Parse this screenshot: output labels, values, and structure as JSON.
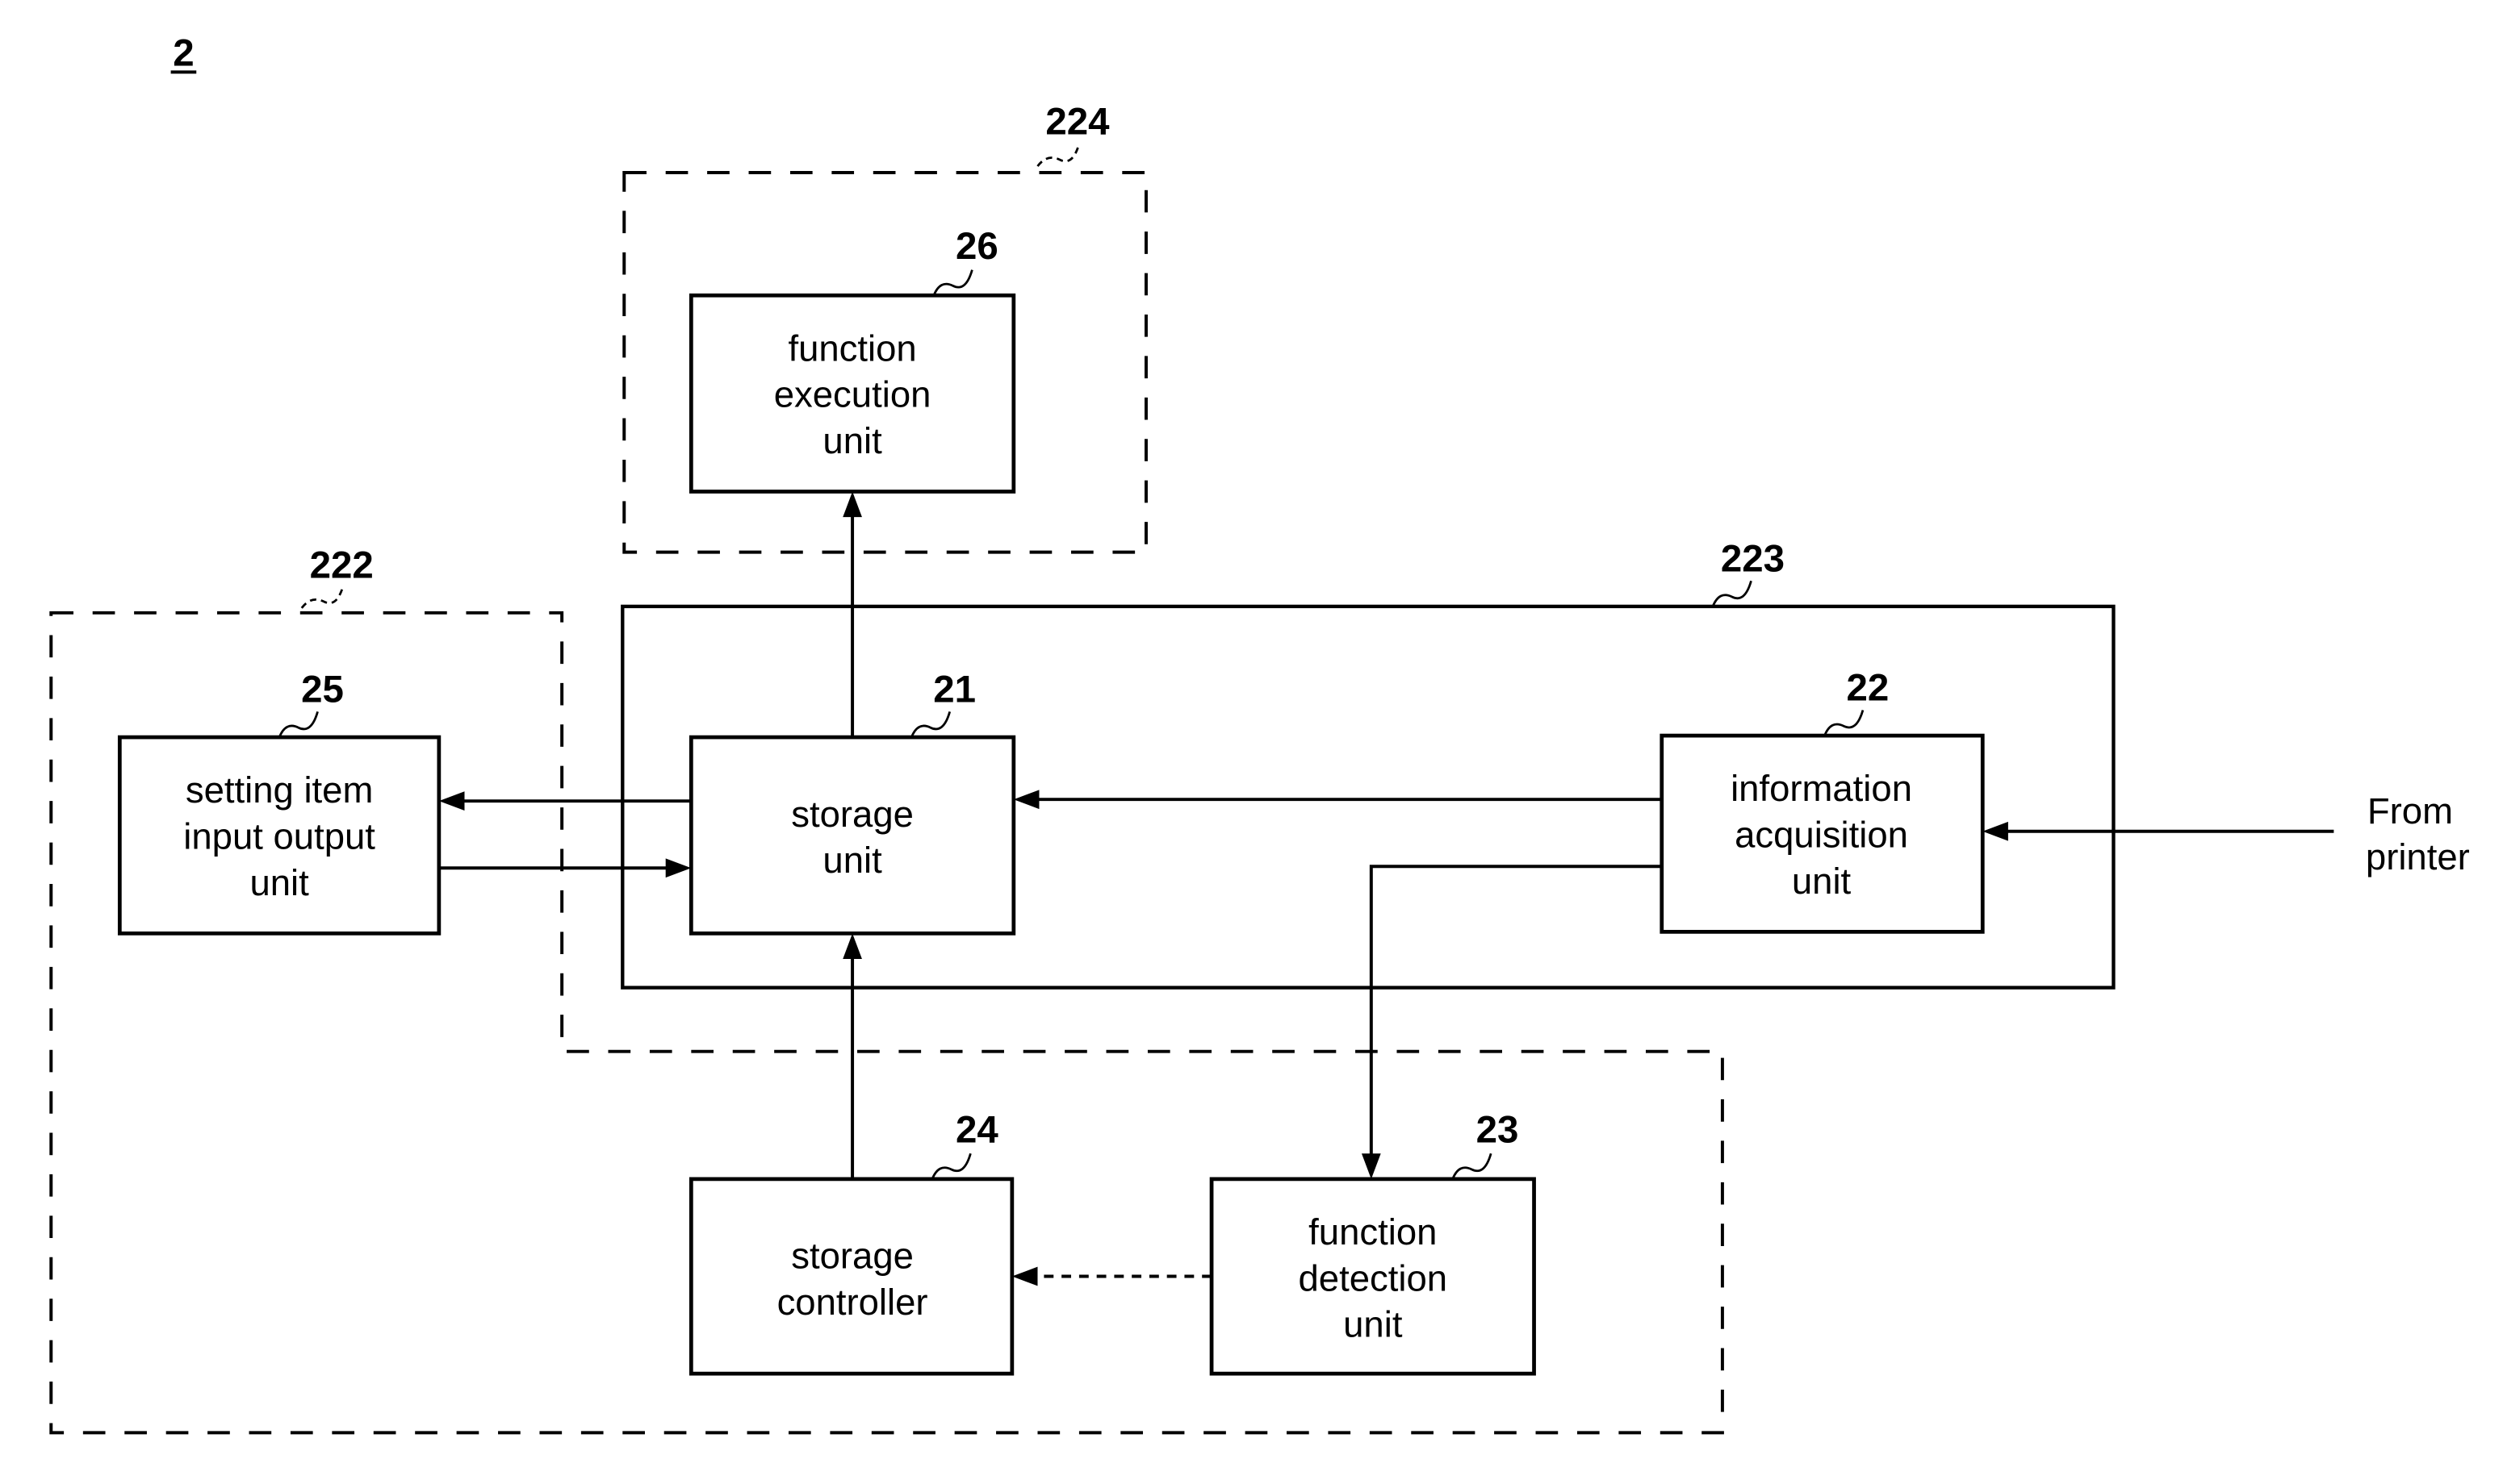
{
  "figure": {
    "number": "2"
  },
  "groups": [
    {
      "id": "222",
      "ref": "222",
      "style": "dashed",
      "contains": [
        "25",
        "24",
        "23"
      ]
    },
    {
      "id": "223",
      "ref": "223",
      "style": "solid",
      "contains": [
        "21",
        "22"
      ]
    },
    {
      "id": "224",
      "ref": "224",
      "style": "dashed",
      "contains": [
        "26"
      ]
    }
  ],
  "blocks": [
    {
      "id": "21",
      "ref": "21",
      "lines": [
        "storage",
        "unit"
      ]
    },
    {
      "id": "22",
      "ref": "22",
      "lines": [
        "information",
        "acquisition",
        "unit"
      ]
    },
    {
      "id": "23",
      "ref": "23",
      "lines": [
        "function",
        "detection",
        "unit"
      ]
    },
    {
      "id": "24",
      "ref": "24",
      "lines": [
        "storage",
        "controller"
      ]
    },
    {
      "id": "25",
      "ref": "25",
      "lines": [
        "setting item",
        "input output",
        "unit"
      ]
    },
    {
      "id": "26",
      "ref": "26",
      "lines": [
        "function",
        "execution",
        "unit"
      ]
    }
  ],
  "external": {
    "printer": {
      "lines": [
        "From",
        "printer"
      ]
    }
  },
  "connections": [
    {
      "from": "21",
      "to": "26",
      "style": "solid"
    },
    {
      "from": "21",
      "to": "25",
      "style": "solid"
    },
    {
      "from": "25",
      "to": "21",
      "style": "solid"
    },
    {
      "from": "22",
      "to": "21",
      "style": "solid"
    },
    {
      "from": "22",
      "to": "23",
      "style": "solid"
    },
    {
      "from": "24",
      "to": "21",
      "style": "solid"
    },
    {
      "from": "23",
      "to": "24",
      "style": "dashed"
    },
    {
      "from": "printer",
      "to": "22",
      "style": "solid"
    }
  ]
}
